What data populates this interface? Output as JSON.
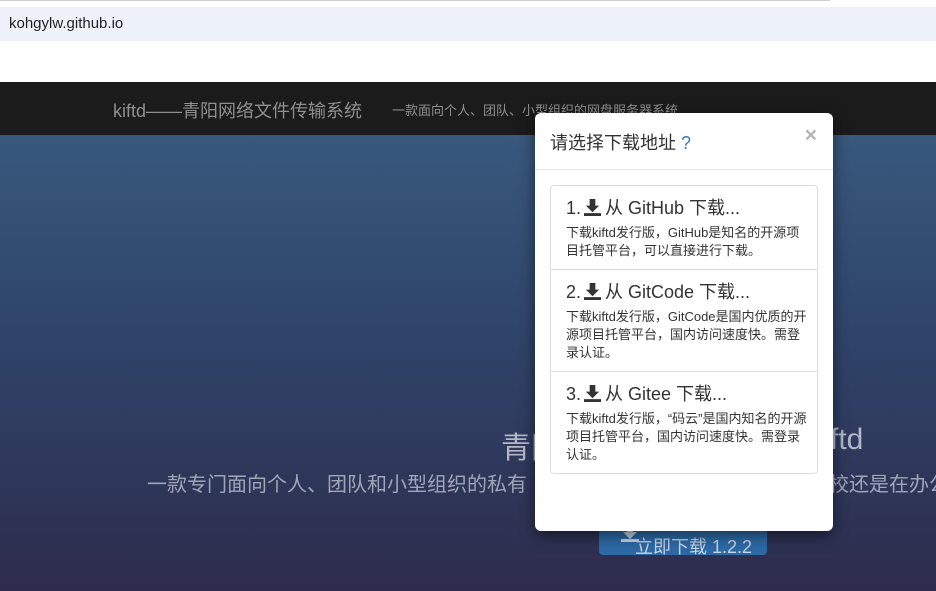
{
  "browser": {
    "url": "kohgylw.github.io"
  },
  "navbar": {
    "brand": "kiftd——青阳网络文件传输系统",
    "subtitle": "一款面向个人、团队、小型组织的网盘服务器系统"
  },
  "hero": {
    "title_left": "青阳",
    "title_right": "ftd",
    "subtitle_left": "一款专门面向个人、团队和小型组织的私有",
    "subtitle_right": "校还是在办公",
    "download_button": "立即下载 1.2.2"
  },
  "modal": {
    "title": "请选择下载地址",
    "help": "?",
    "close": "×",
    "options": [
      {
        "num": "1.",
        "label": "从 GitHub 下载...",
        "desc": "下载kiftd发行版，GitHub是知名的开源项目托管平台，可以直接进行下载。"
      },
      {
        "num": "2.",
        "label": "从 GitCode 下载...",
        "desc": "下载kiftd发行版，GitCode是国内优质的开源项目托管平台，国内访问速度快。需登录认证。"
      },
      {
        "num": "3.",
        "label": "从 Gitee 下载...",
        "desc": "下载kiftd发行版，“码云”是国内知名的开源项目托管平台，国内访问速度快。需登录认证。"
      }
    ]
  },
  "icons": {
    "download": "download-icon"
  },
  "colors": {
    "navbar": "#1b1b1b",
    "link": "#337ab7",
    "button": "#2d6aa6"
  }
}
